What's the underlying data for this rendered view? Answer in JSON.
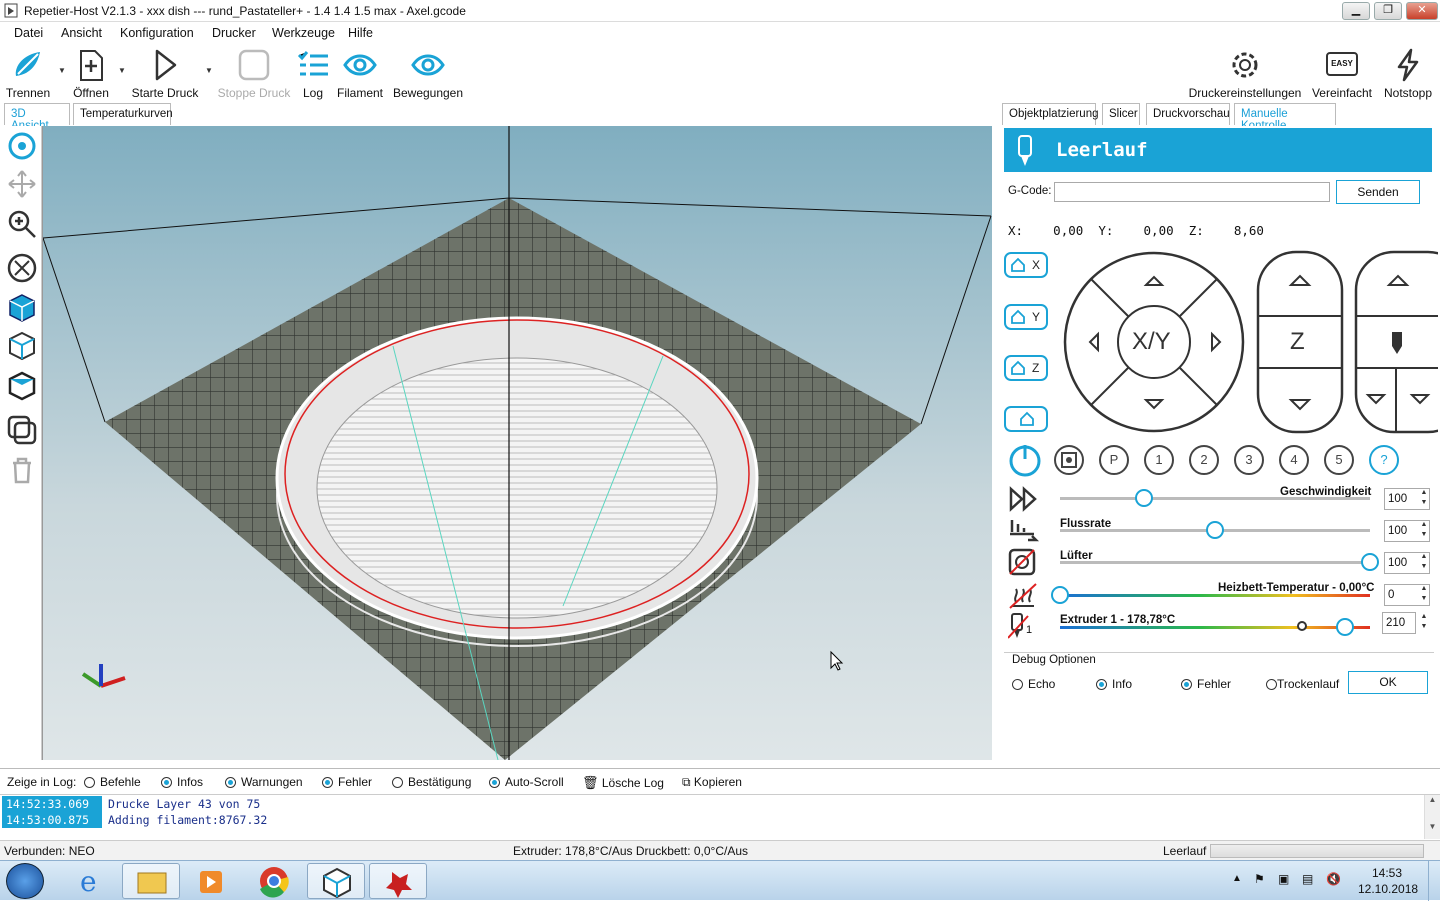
{
  "window": {
    "title": "Repetier-Host V2.1.3 - xxx dish --- rund_Pastateller+ - 1.4 1.4 1.5 max - Axel.gcode"
  },
  "menu": [
    "Datei",
    "Ansicht",
    "Konfiguration",
    "Drucker",
    "Werkzeuge",
    "Hilfe"
  ],
  "toolbar": {
    "slice": "Trennen",
    "open": "Öffnen",
    "start": "Starte Druck",
    "stop": "Stoppe Druck",
    "log": "Log",
    "filament": "Filament",
    "moves": "Bewegungen",
    "printer_settings": "Druckereinstellungen",
    "easy": "Vereinfacht",
    "easy_badge": "EASY",
    "emergency": "Notstopp"
  },
  "left_tabs": {
    "view3d": "3D Ansicht",
    "temp": "Temperaturkurven"
  },
  "right_tabs": {
    "placement": "Objektplatzierung",
    "slicer": "Slicer",
    "preview": "Druckvorschau",
    "manual": "Manuelle Kontrolle"
  },
  "manual": {
    "status": "Leerlauf",
    "gcode_label": "G-Code:",
    "gcode_value": "",
    "send": "Senden",
    "x_label": "X:",
    "x_val": "0,00",
    "y_label": "Y:",
    "y_val": "0,00",
    "z_label": "Z:",
    "z_val": "8,60",
    "home_x": "X",
    "home_y": "Y",
    "home_z": "Z",
    "xy_label": "X/Y",
    "z_pad": "Z",
    "buttons": [
      "P",
      "1",
      "2",
      "3",
      "4",
      "5",
      "?"
    ],
    "speed_label": "Geschwindigkeit",
    "speed_val": "100",
    "speed_frac": 0.27,
    "flow_label": "Flussrate",
    "flow_val": "100",
    "flow_frac": 0.5,
    "fan_label": "Lüfter",
    "fan_val": "100",
    "fan_frac": 1.0,
    "bed_label": "Heizbett-Temperatur - 0,00°C",
    "bed_val": "0",
    "bed_frac": 0.0,
    "ext_label": "Extruder 1 - 178,78°C",
    "ext_val": "210",
    "ext_frac": 0.92,
    "ext_marker_frac": 0.78,
    "ext_num": "1",
    "debug_title": "Debug Optionen",
    "debug": [
      {
        "label": "Echo",
        "on": false
      },
      {
        "label": "Info",
        "on": true
      },
      {
        "label": "Fehler",
        "on": true
      },
      {
        "label": "Trockenlauf",
        "on": false
      }
    ],
    "ok": "OK"
  },
  "log": {
    "show_label": "Zeige in Log:",
    "opts": [
      {
        "label": "Befehle",
        "on": false
      },
      {
        "label": "Infos",
        "on": true
      },
      {
        "label": "Warnungen",
        "on": true
      },
      {
        "label": "Fehler",
        "on": true
      },
      {
        "label": "Bestätigung",
        "on": false
      },
      {
        "label": "Auto-Scroll",
        "on": true
      }
    ],
    "clear": "Lösche Log",
    "copy": "Kopieren",
    "lines": [
      {
        "time": "14:52:33.069",
        "msg": "Drucke Layer 43 von 75"
      },
      {
        "time": "14:53:00.875",
        "msg": "Adding filament:8767.32"
      }
    ]
  },
  "status": {
    "connected": "Verbunden: NEO",
    "temps": "Extruder: 178,8°C/Aus Druckbett: 0,0°C/Aus",
    "state": "Leerlauf"
  },
  "taskbar": {
    "time": "14:53",
    "date": "12.10.2018"
  },
  "colors": {
    "accent": "#1aa3d6"
  }
}
